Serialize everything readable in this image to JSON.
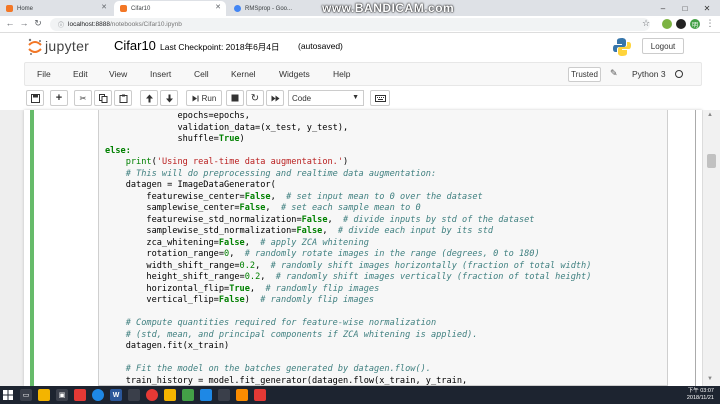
{
  "browser": {
    "tabs": [
      {
        "label": "Home",
        "color": "#f37726"
      },
      {
        "label": "Cifar10",
        "color": "#f37726"
      },
      {
        "label": "RMSprop - Goo...",
        "color": "#4285f4"
      }
    ],
    "url": "localhost:8888",
    "url_path": "/notebooks/Cifar10.ipynb",
    "recorder_left": "www.",
    "recorder_right": "BANDICAM",
    "recorder_dot": ".com",
    "profile_initials": "明"
  },
  "jupyter": {
    "brand": "jupyter",
    "notebook_title": "Cifar10",
    "checkpoint": "Last Checkpoint: 2018年6月4日",
    "save_status": "(autosaved)",
    "logout": "Logout",
    "menu": [
      "File",
      "Edit",
      "View",
      "Insert",
      "Cell",
      "Kernel",
      "Widgets",
      "Help"
    ],
    "trusted": "Trusted",
    "kernel": "Python 3",
    "run_label": "Run",
    "cell_type": "Code"
  },
  "code_lines": [
    {
      "indent": "              ",
      "parts": [
        {
          "t": "epochs=epochs,",
          "c": ""
        }
      ]
    },
    {
      "indent": "              ",
      "parts": [
        {
          "t": "validation_data=(x_test, y_test),",
          "c": ""
        }
      ]
    },
    {
      "indent": "              ",
      "parts": [
        {
          "t": "shuffle=",
          "c": ""
        },
        {
          "t": "True",
          "c": "kw"
        },
        {
          "t": ")",
          "c": ""
        }
      ]
    },
    {
      "indent": "",
      "parts": [
        {
          "t": "else:",
          "c": "kw"
        }
      ]
    },
    {
      "indent": "    ",
      "parts": [
        {
          "t": "print",
          "c": "nm"
        },
        {
          "t": "(",
          "c": ""
        },
        {
          "t": "'Using real-time data augmentation.'",
          "c": "st"
        },
        {
          "t": ")",
          "c": ""
        }
      ]
    },
    {
      "indent": "    ",
      "parts": [
        {
          "t": "# This will do preprocessing and realtime data augmentation:",
          "c": "cm"
        }
      ]
    },
    {
      "indent": "    ",
      "parts": [
        {
          "t": "datagen = ImageDataGenerator(",
          "c": ""
        }
      ]
    },
    {
      "indent": "        ",
      "parts": [
        {
          "t": "featurewise_center=",
          "c": ""
        },
        {
          "t": "False",
          "c": "kw"
        },
        {
          "t": ",  ",
          "c": ""
        },
        {
          "t": "# set input mean to 0 over the dataset",
          "c": "cm"
        }
      ]
    },
    {
      "indent": "        ",
      "parts": [
        {
          "t": "samplewise_center=",
          "c": ""
        },
        {
          "t": "False",
          "c": "kw"
        },
        {
          "t": ",  ",
          "c": ""
        },
        {
          "t": "# set each sample mean to 0",
          "c": "cm"
        }
      ]
    },
    {
      "indent": "        ",
      "parts": [
        {
          "t": "featurewise_std_normalization=",
          "c": ""
        },
        {
          "t": "False",
          "c": "kw"
        },
        {
          "t": ",  ",
          "c": ""
        },
        {
          "t": "# divide inputs by std of the dataset",
          "c": "cm"
        }
      ]
    },
    {
      "indent": "        ",
      "parts": [
        {
          "t": "samplewise_std_normalization=",
          "c": ""
        },
        {
          "t": "False",
          "c": "kw"
        },
        {
          "t": ",  ",
          "c": ""
        },
        {
          "t": "# divide each input by its std",
          "c": "cm"
        }
      ]
    },
    {
      "indent": "        ",
      "parts": [
        {
          "t": "zca_whitening=",
          "c": ""
        },
        {
          "t": "False",
          "c": "kw"
        },
        {
          "t": ",  ",
          "c": ""
        },
        {
          "t": "# apply ZCA whitening",
          "c": "cm"
        }
      ]
    },
    {
      "indent": "        ",
      "parts": [
        {
          "t": "rotation_range=",
          "c": ""
        },
        {
          "t": "0",
          "c": "nm"
        },
        {
          "t": ",  ",
          "c": ""
        },
        {
          "t": "# randomly rotate images in the range (degrees, 0 to 180)",
          "c": "cm"
        }
      ]
    },
    {
      "indent": "        ",
      "parts": [
        {
          "t": "width_shift_range=",
          "c": ""
        },
        {
          "t": "0.2",
          "c": "nm"
        },
        {
          "t": ",  ",
          "c": ""
        },
        {
          "t": "# randomly shift images horizontally (fraction of total width)",
          "c": "cm"
        }
      ]
    },
    {
      "indent": "        ",
      "parts": [
        {
          "t": "height_shift_range=",
          "c": ""
        },
        {
          "t": "0.2",
          "c": "nm"
        },
        {
          "t": ",  ",
          "c": ""
        },
        {
          "t": "# randomly shift images vertically (fraction of total height)",
          "c": "cm"
        }
      ]
    },
    {
      "indent": "        ",
      "parts": [
        {
          "t": "horizontal_flip=",
          "c": ""
        },
        {
          "t": "True",
          "c": "kw"
        },
        {
          "t": ",  ",
          "c": ""
        },
        {
          "t": "# randomly flip images",
          "c": "cm"
        }
      ]
    },
    {
      "indent": "        ",
      "parts": [
        {
          "t": "vertical_flip=",
          "c": ""
        },
        {
          "t": "False",
          "c": "kw"
        },
        {
          "t": ")  ",
          "c": ""
        },
        {
          "t": "# randomly flip images",
          "c": "cm"
        }
      ]
    },
    {
      "indent": "",
      "parts": [
        {
          "t": "",
          "c": ""
        }
      ]
    },
    {
      "indent": "    ",
      "parts": [
        {
          "t": "# Compute quantities required for feature-wise normalization",
          "c": "cm"
        }
      ]
    },
    {
      "indent": "    ",
      "parts": [
        {
          "t": "# (std, mean, and principal components if ZCA whitening is applied).",
          "c": "cm"
        }
      ]
    },
    {
      "indent": "    ",
      "parts": [
        {
          "t": "datagen.fit(x_train)",
          "c": ""
        }
      ]
    },
    {
      "indent": "",
      "parts": [
        {
          "t": "",
          "c": ""
        }
      ]
    },
    {
      "indent": "    ",
      "parts": [
        {
          "t": "# Fit the model on the batches generated by datagen.flow().",
          "c": "cm"
        }
      ]
    },
    {
      "indent": "    ",
      "parts": [
        {
          "t": "train_history = model.fit_generator(datagen.flow(x_train, y_train,",
          "c": ""
        }
      ]
    }
  ],
  "taskbar": {
    "time": "下午 03:07",
    "date": "2018/11/21"
  }
}
